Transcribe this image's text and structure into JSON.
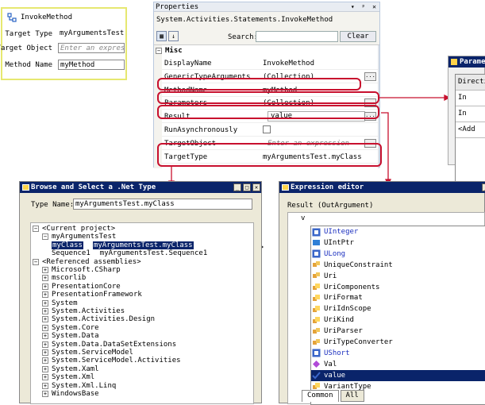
{
  "activity": {
    "title": "InvokeMethod",
    "fields": [
      {
        "label": "Target Type",
        "value": "myArgumentsTest.m",
        "style": "plain"
      },
      {
        "label": "Target Object",
        "value": "Enter an express:",
        "style": "placeholder"
      },
      {
        "label": "Method Name",
        "value": "myMethod",
        "style": "box"
      }
    ]
  },
  "properties": {
    "header": "Properties",
    "header_buttons": "▾ ᵖ ✕",
    "type_name": "System.Activities.Statements.InvokeMethod",
    "search_label": "Search:",
    "clear_label": "Clear",
    "category": "Misc",
    "rows": [
      {
        "name": "DisplayName",
        "value": "InvokeMethod"
      },
      {
        "name": "GenericTypeArguments",
        "value": "(Collection)",
        "ellipsis": "..."
      },
      {
        "name": "MethodName",
        "value": "myMethod"
      },
      {
        "name": "Parameters",
        "value": "(Collection)",
        "ellipsis": "..."
      },
      {
        "name": "Result",
        "value": "value",
        "ellipsis": "..."
      },
      {
        "name": "RunAsynchronously",
        "value": ""
      },
      {
        "name": "TargetObject",
        "value": "Enter an expression",
        "ellipsis": "..."
      },
      {
        "name": "TargetType",
        "value": "myArgumentsTest.myClass"
      }
    ]
  },
  "params_window": {
    "title": "Parame",
    "cells": [
      "Directi",
      "In",
      "In",
      "<Add"
    ]
  },
  "browse": {
    "title": "Browse and Select a .Net Type",
    "type_name_label": "Type Name:",
    "type_name_value": "myArgumentsTest.myClass",
    "tree": [
      {
        "text": "<Current project>",
        "expander": "−"
      },
      {
        "text": "myArgumentsTest",
        "expander": "−"
      },
      {
        "text": "myClass",
        "extra": "myArgumentsTest.myClass",
        "selected": true
      },
      {
        "text": "Sequence1",
        "extra": "myArgumentsTest.Sequence1"
      },
      {
        "text": "<Referenced assemblies>",
        "expander": "−"
      },
      {
        "text": "Microsoft.CSharp",
        "expander": "+"
      },
      {
        "text": "mscorlib",
        "expander": "+"
      },
      {
        "text": "PresentationCore",
        "expander": "+"
      },
      {
        "text": "PresentationFramework",
        "expander": "+"
      },
      {
        "text": "System",
        "expander": "+"
      },
      {
        "text": "System.Activities",
        "expander": "+"
      },
      {
        "text": "System.Activities.Design",
        "expander": "+"
      },
      {
        "text": "System.Core",
        "expander": "+"
      },
      {
        "text": "System.Data",
        "expander": "+"
      },
      {
        "text": "System.Data.DataSetExtensions",
        "expander": "+"
      },
      {
        "text": "System.ServiceModel",
        "expander": "+"
      },
      {
        "text": "System.ServiceModel.Activities",
        "expander": "+"
      },
      {
        "text": "System.Xaml",
        "expander": "+"
      },
      {
        "text": "System.Xml",
        "expander": "+"
      },
      {
        "text": "System.Xml.Linq",
        "expander": "+"
      },
      {
        "text": "WindowsBase",
        "expander": "+"
      }
    ]
  },
  "expression_editor": {
    "title": "Expression editor",
    "result_label": "Result (OutArgument)",
    "typed_text": "v",
    "items": [
      {
        "text": "UInteger",
        "icon": "type-icon",
        "color": "#1b2fbf"
      },
      {
        "text": "UIntPtr",
        "icon": "struct-icon",
        "color": "#000000"
      },
      {
        "text": "ULong",
        "icon": "type-icon",
        "color": "#1b2fbf"
      },
      {
        "text": "UniqueConstraint",
        "icon": "class-icon",
        "color": "#000000"
      },
      {
        "text": "Uri",
        "icon": "class-icon",
        "color": "#000000"
      },
      {
        "text": "UriComponents",
        "icon": "enum-icon",
        "color": "#000000"
      },
      {
        "text": "UriFormat",
        "icon": "enum-icon",
        "color": "#000000"
      },
      {
        "text": "UriIdnScope",
        "icon": "enum-icon",
        "color": "#000000"
      },
      {
        "text": "UriKind",
        "icon": "enum-icon",
        "color": "#000000"
      },
      {
        "text": "UriParser",
        "icon": "class-icon",
        "color": "#000000"
      },
      {
        "text": "UriTypeConverter",
        "icon": "class-icon",
        "color": "#000000"
      },
      {
        "text": "UShort",
        "icon": "type-icon",
        "color": "#1b2fbf"
      },
      {
        "text": "Val",
        "icon": "method-icon",
        "color": "#000000"
      },
      {
        "text": "value",
        "icon": "variable-icon",
        "color": "#000000",
        "selected": true
      },
      {
        "text": "VariantType",
        "icon": "enum-icon",
        "color": "#000000"
      }
    ],
    "tabs": [
      "Common",
      "All"
    ]
  },
  "colors": {
    "highlight_red": "#c8102e",
    "titlebar": "#0a246a",
    "designer_border": "#e6e870"
  }
}
